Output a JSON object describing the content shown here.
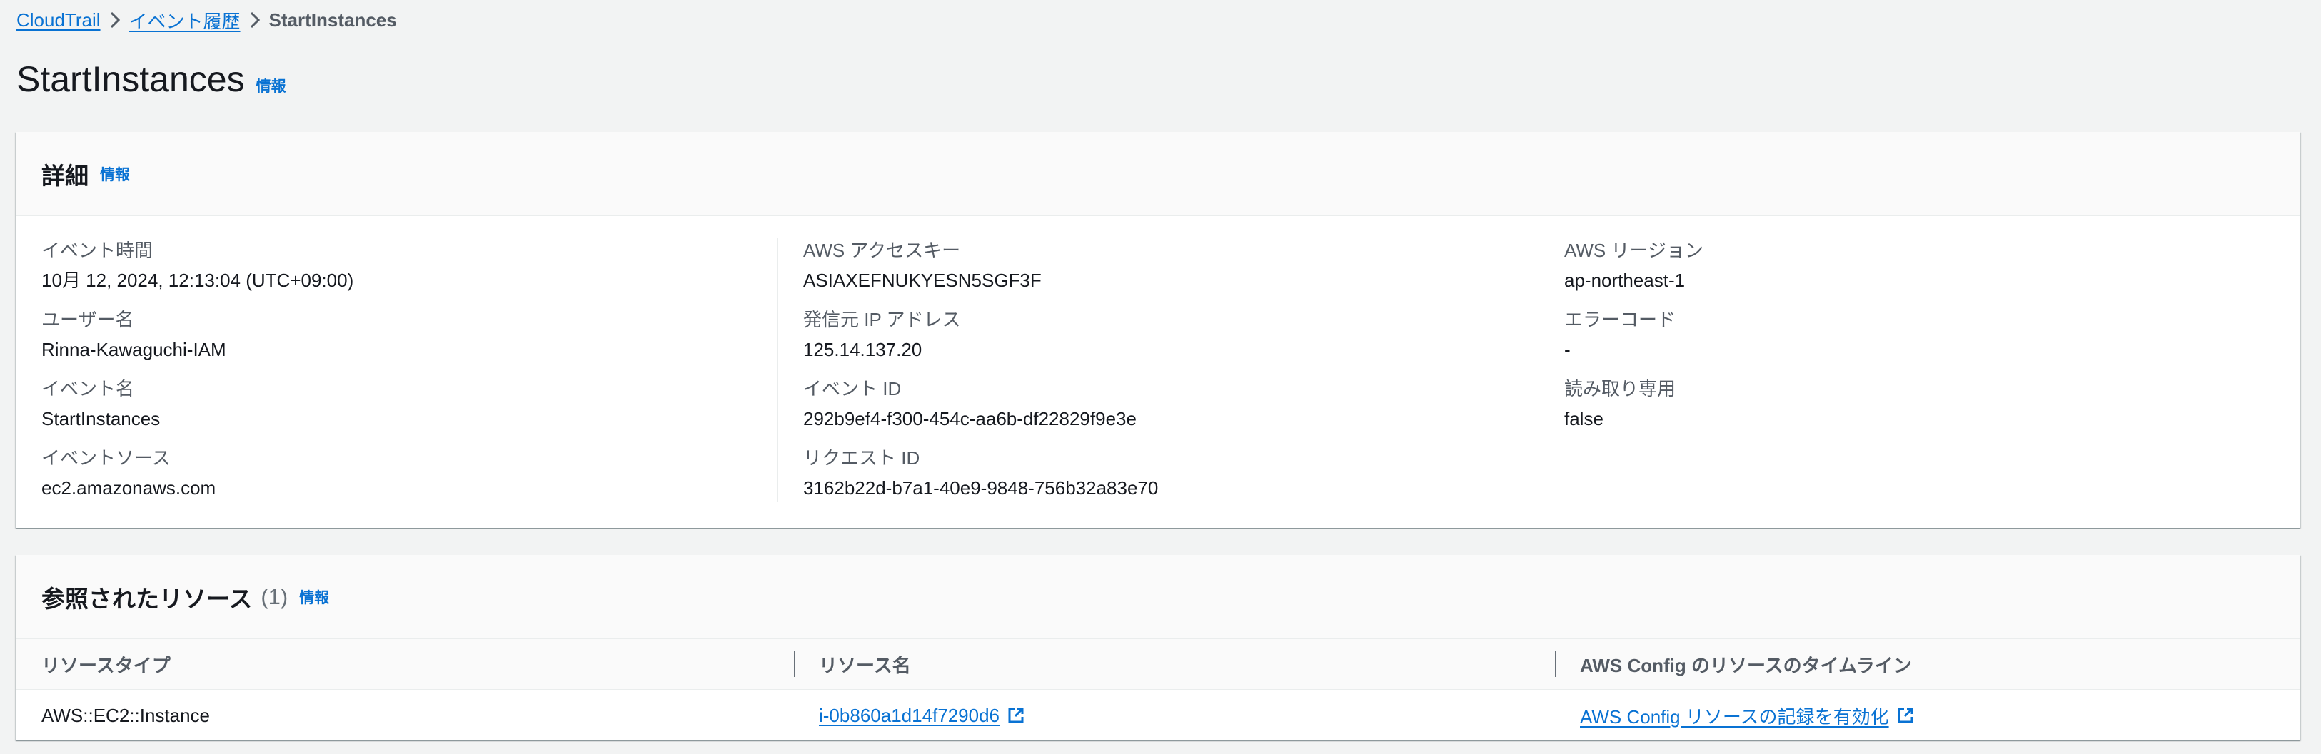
{
  "breadcrumb": {
    "items": [
      "CloudTrail",
      "イベント履歴"
    ],
    "current": "StartInstances"
  },
  "page": {
    "title": "StartInstances",
    "info_label": "情報"
  },
  "details": {
    "heading": "詳細",
    "info_label": "情報",
    "columns": [
      [
        {
          "label": "イベント時間",
          "value": "10月 12, 2024, 12:13:04 (UTC+09:00)"
        },
        {
          "label": "ユーザー名",
          "value": "Rinna-Kawaguchi-IAM"
        },
        {
          "label": "イベント名",
          "value": "StartInstances"
        },
        {
          "label": "イベントソース",
          "value": "ec2.amazonaws.com"
        }
      ],
      [
        {
          "label": "AWS アクセスキー",
          "value": "ASIAXEFNUKYESN5SGF3F"
        },
        {
          "label": "発信元 IP アドレス",
          "value": "125.14.137.20"
        },
        {
          "label": "イベント ID",
          "value": "292b9ef4-f300-454c-aa6b-df22829f9e3e"
        },
        {
          "label": "リクエスト ID",
          "value": "3162b22d-b7a1-40e9-9848-756b32a83e70"
        }
      ],
      [
        {
          "label": "AWS リージョン",
          "value": "ap-northeast-1"
        },
        {
          "label": "エラーコード",
          "value": "-"
        },
        {
          "label": "読み取り専用",
          "value": "false"
        }
      ]
    ]
  },
  "resources": {
    "heading": "参照されたリソース",
    "count": "(1)",
    "info_label": "情報",
    "columns": [
      "リソースタイプ",
      "リソース名",
      "AWS Config のリソースのタイムライン"
    ],
    "rows": [
      {
        "type": "AWS::EC2::Instance",
        "name": "i-0b860a1d14f7290d6",
        "config_link": "AWS Config リソースの記録を有効化"
      }
    ]
  },
  "colors": {
    "link": "#0972d3",
    "background": "#f2f3f3",
    "text": "#16191f",
    "label": "#545b64"
  }
}
